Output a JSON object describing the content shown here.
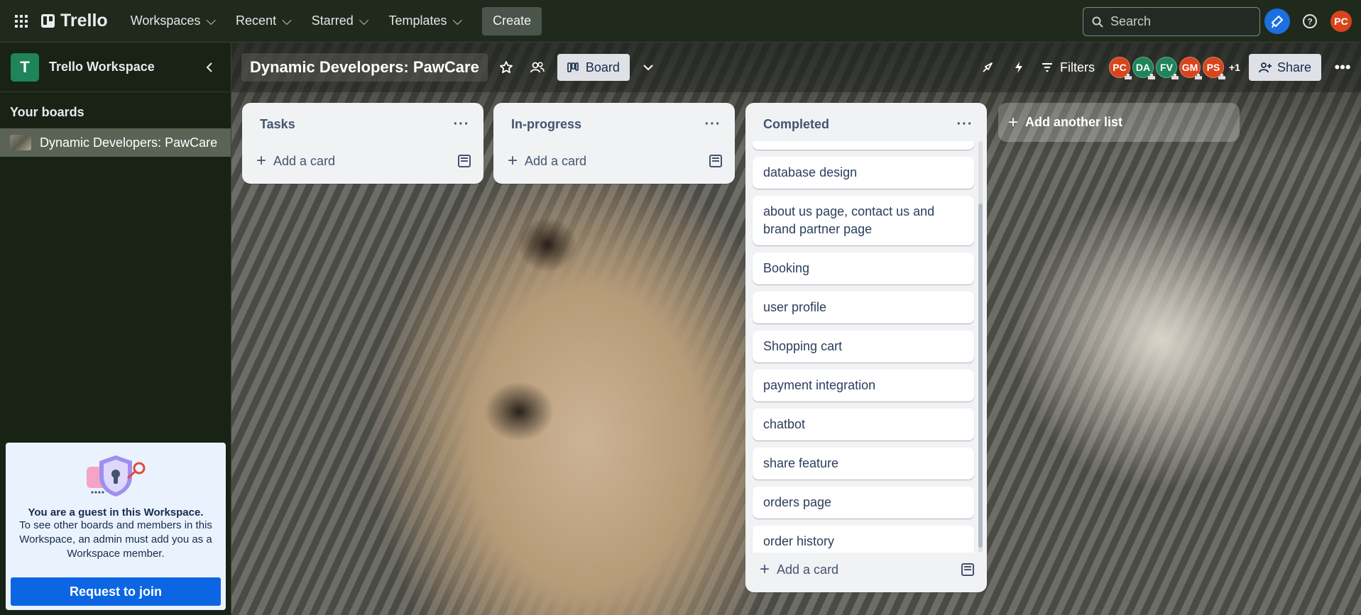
{
  "topbar": {
    "logo": "Trello",
    "nav": [
      "Workspaces",
      "Recent",
      "Starred",
      "Templates"
    ],
    "create_label": "Create",
    "search_placeholder": "Search",
    "user_initials": "PC"
  },
  "sidebar": {
    "workspace_initial": "T",
    "workspace_name": "Trello Workspace",
    "section_title": "Your boards",
    "boards": [
      "Dynamic Developers: PawCare"
    ],
    "guest": {
      "title": "You are a guest in this Workspace.",
      "body": "To see other boards and members in this Workspace, an admin must add you as a Workspace member.",
      "button": "Request to join"
    }
  },
  "board": {
    "title": "Dynamic Developers: PawCare",
    "view_label": "Board",
    "filters_label": "Filters",
    "members": [
      {
        "initials": "PC",
        "color": "#d9441b"
      },
      {
        "initials": "DA",
        "color": "#1f845a"
      },
      {
        "initials": "FV",
        "color": "#1f845a"
      },
      {
        "initials": "GM",
        "color": "#d9441b"
      },
      {
        "initials": "PS",
        "color": "#d9441b"
      }
    ],
    "more_members": "+1",
    "share_label": "Share",
    "add_list_label": "Add another list"
  },
  "lists": {
    "tasks": {
      "title": "Tasks",
      "add_label": "Add a card"
    },
    "inprogress": {
      "title": "In-progress",
      "add_label": "Add a card"
    },
    "completed": {
      "title": "Completed",
      "add_label": "Add a card",
      "cards": [
        "database design",
        "about us page, contact us and brand partner page",
        "Booking",
        "user profile",
        "Shopping cart",
        "payment integration",
        "chatbot",
        "share feature",
        "orders page",
        "order history"
      ]
    }
  }
}
